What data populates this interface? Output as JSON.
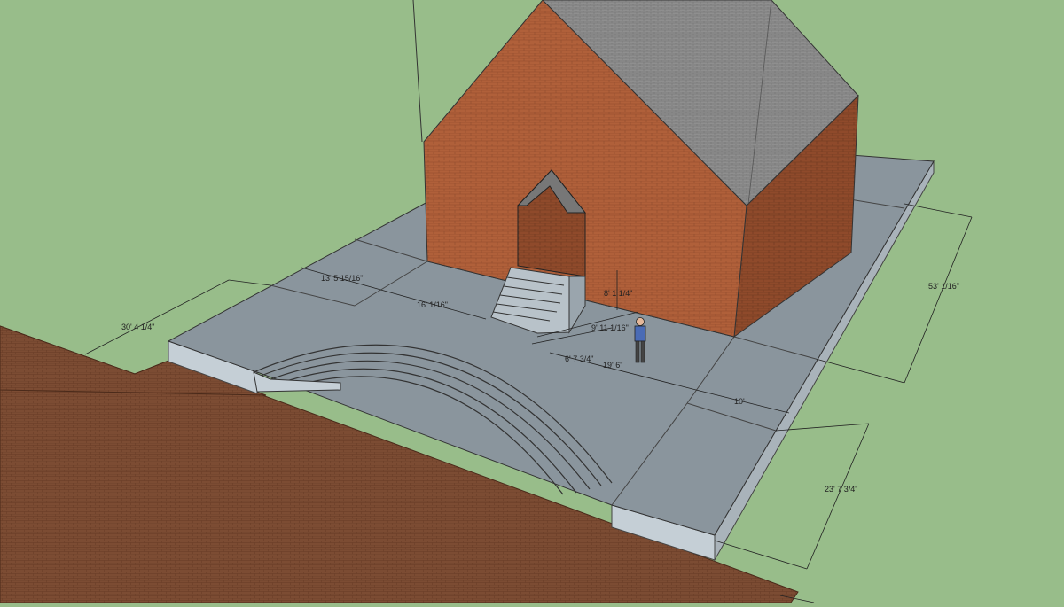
{
  "scene": {
    "colors": {
      "ground": "#98bd8a",
      "concrete_top": "#8a959d",
      "concrete_side": "#c5cfd6",
      "brick": "#b0603a",
      "brick_side": "#8f4a2b",
      "roof": "#8e8e8e",
      "road": "#7a4a32"
    },
    "dimensions": {
      "d1": "13' 5 15/16\"",
      "d2": "16' 1/16\"",
      "d3": "30' 4 1/4\"",
      "d4": "8' 1 1/4\"",
      "d5": "9' 11 1/16\"",
      "d6": "6' 7 3/4\"",
      "d7": "19' 6\"",
      "d8": "53' 1/16\"",
      "d9": "10'",
      "d10": "23' 7 3/4\""
    }
  }
}
